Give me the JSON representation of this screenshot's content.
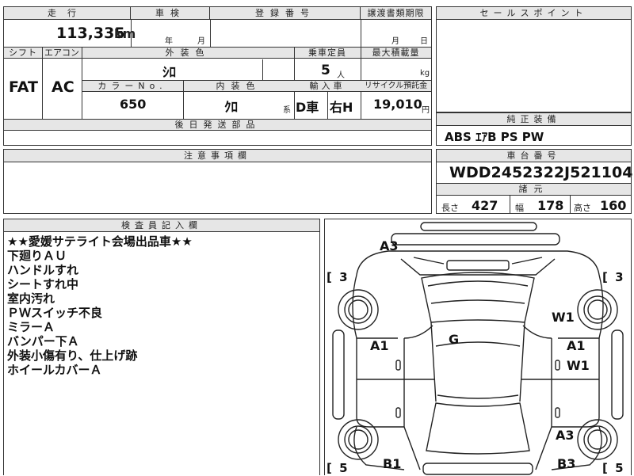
{
  "top_table": {
    "mileage_label": "走行",
    "mileage_value": "113,335",
    "mileage_unit": "km",
    "inspection_label": "車検",
    "inspection_year_unit": "年",
    "inspection_month_unit": "月",
    "registration_label": "登録番号",
    "transfer_label": "譲渡書類期限",
    "transfer_month_unit": "月",
    "transfer_day_unit": "日",
    "shift_label": "シフト",
    "shift_value": "FAT",
    "ac_label": "エアコン",
    "ac_value": "AC",
    "exterior_label": "外装色",
    "exterior_value": "ｼﾛ",
    "capacity_label": "乗車定員",
    "capacity_value": "5",
    "capacity_unit": "人",
    "load_label": "最大積載量",
    "load_unit": "kg",
    "color_no_label": "カラーNo.",
    "color_no_value": "650",
    "interior_label": "内装色",
    "interior_value": "ｸﾛ",
    "interior_suffix": "系",
    "import_label": "輸入車",
    "import_value": "D車",
    "steering_value": "右H",
    "recycle_label": "リサイクル預託金",
    "recycle_value": "19,010",
    "recycle_unit": "円",
    "later_parts_label": "後日発送部品"
  },
  "sales_point": {
    "label": "セールスポイント"
  },
  "genuine_equipment": {
    "label": "純正装備",
    "value": "ABS ｴｱB PS PW"
  },
  "caution": {
    "label": "注意事項欄"
  },
  "chassis": {
    "label": "車台番号",
    "value": "WDD2452322J521104"
  },
  "dimensions": {
    "label": "諸元",
    "length_label": "長さ",
    "length_value": "427",
    "width_label": "幅",
    "width_value": "178",
    "height_label": "高さ",
    "height_value": "160"
  },
  "inspector": {
    "label": "検査員記入欄",
    "notes": [
      "★★愛媛サテライト会場出品車★★",
      "下廻りＡＵ",
      "ハンドルすれ",
      "シートすれ中",
      "室内汚れ",
      "ＰＷスイッチ不良",
      "ミラーＡ",
      "バンパー下Ａ",
      "外装小傷有り、仕上げ跡",
      "ホイールカバーＡ"
    ]
  },
  "diagram": {
    "marks": {
      "front_bumper": "A3",
      "windshield": "G",
      "right_front_fender": "W1",
      "left_front_door": "A1",
      "right_front_door_a": "A1",
      "right_front_door_w": "W1",
      "right_rear_fender": "A3",
      "left_rear": "B1",
      "right_rear": "B3"
    },
    "brackets": {
      "front_left": "[ 3",
      "front_right": "[ 3",
      "rear_left": "[ 5",
      "rear_right": "[ 5"
    }
  }
}
